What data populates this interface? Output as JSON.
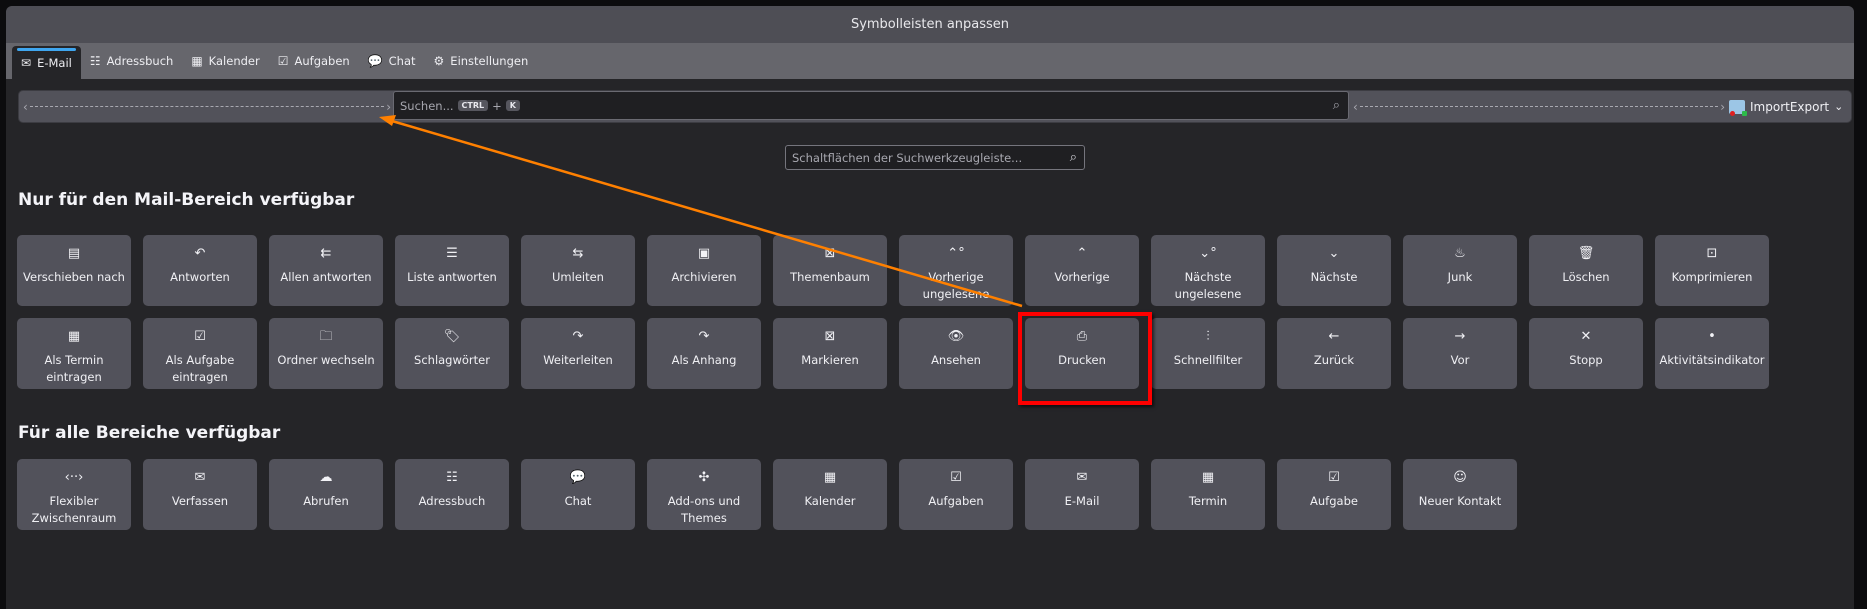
{
  "window": {
    "title": "Symbolleisten anpassen"
  },
  "tabs": [
    {
      "label": "E-Mail",
      "icon": "mail-icon",
      "glyph": "✉",
      "active": true
    },
    {
      "label": "Adressbuch",
      "icon": "address-book-icon",
      "glyph": "☷"
    },
    {
      "label": "Kalender",
      "icon": "calendar-icon",
      "glyph": "▦"
    },
    {
      "label": "Aufgaben",
      "icon": "tasks-icon",
      "glyph": "☑"
    },
    {
      "label": "Chat",
      "icon": "chat-icon",
      "glyph": "💬"
    },
    {
      "label": "Einstellungen",
      "icon": "gear-icon",
      "glyph": "⚙"
    }
  ],
  "toolbar": {
    "search_placeholder": "Suchen...",
    "shortcut_key1": "CTRL",
    "shortcut_plus": "+",
    "shortcut_key2": "K",
    "importexport_label": "ImportExport"
  },
  "filter": {
    "placeholder": "Schaltflächen der Suchwerkzeugleiste..."
  },
  "sections": [
    {
      "title": "Nur für den Mail-Bereich verfügbar",
      "rows": [
        [
          {
            "label": "Verschieben nach",
            "icon": "file-move-icon",
            "glyph": "▤"
          },
          {
            "label": "Antworten",
            "icon": "reply-icon",
            "glyph": "↶"
          },
          {
            "label": "Allen antworten",
            "icon": "reply-all-icon",
            "glyph": "⇇"
          },
          {
            "label": "Liste antworten",
            "icon": "reply-list-icon",
            "glyph": "☰"
          },
          {
            "label": "Umleiten",
            "icon": "redirect-icon",
            "glyph": "⇆"
          },
          {
            "label": "Archivieren",
            "icon": "archive-icon",
            "glyph": "▣"
          },
          {
            "label": "Themenbaum",
            "icon": "thread-icon",
            "glyph": "⊠"
          },
          {
            "label": "Vorherige ungelesene",
            "icon": "previous-unread-icon",
            "glyph": "⌃°"
          },
          {
            "label": "Vorherige",
            "icon": "chevron-up-icon",
            "glyph": "⌃"
          },
          {
            "label": "Nächste ungelesene",
            "icon": "next-unread-icon",
            "glyph": "⌄°"
          },
          {
            "label": "Nächste",
            "icon": "chevron-down-icon",
            "glyph": "⌄"
          },
          {
            "label": "Junk",
            "icon": "junk-flame-icon",
            "glyph": "♨"
          },
          {
            "label": "Löschen",
            "icon": "trash-icon",
            "glyph": "🗑"
          },
          {
            "label": "Komprimieren",
            "icon": "compact-icon",
            "glyph": "⊡"
          }
        ],
        [
          {
            "label": "Als Termin eintragen",
            "icon": "calendar-add-icon",
            "glyph": "▦"
          },
          {
            "label": "Als Aufgabe eintragen",
            "icon": "task-add-icon",
            "glyph": "☑"
          },
          {
            "label": "Ordner wechseln",
            "icon": "folder-icon",
            "glyph": "🗀"
          },
          {
            "label": "Schlagwörter",
            "icon": "tag-icon",
            "glyph": "🏷"
          },
          {
            "label": "Weiterleiten",
            "icon": "forward-icon",
            "glyph": "↷"
          },
          {
            "label": "Als Anhang",
            "icon": "forward-attachment-icon",
            "glyph": "↷"
          },
          {
            "label": "Markieren",
            "icon": "mark-icon",
            "glyph": "⊠"
          },
          {
            "label": "Ansehen",
            "icon": "eye-icon",
            "glyph": "👁"
          },
          {
            "label": "Drucken",
            "icon": "printer-icon",
            "glyph": "⎙"
          },
          {
            "label": "Schnellfilter",
            "icon": "sliders-icon",
            "glyph": "⫶"
          },
          {
            "label": "Zurück",
            "icon": "arrow-left-icon",
            "glyph": "←"
          },
          {
            "label": "Vor",
            "icon": "arrow-right-icon",
            "glyph": "→"
          },
          {
            "label": "Stopp",
            "icon": "close-icon",
            "glyph": "✕"
          },
          {
            "label": "Aktivitätsindikator",
            "icon": "dot-icon",
            "glyph": "•"
          }
        ]
      ]
    },
    {
      "title": "Für alle Bereiche verfügbar",
      "rows": [
        [
          {
            "label": "Flexibler Zwischenraum",
            "icon": "flexible-space-icon",
            "glyph": "‹··›"
          },
          {
            "label": "Verfassen",
            "icon": "compose-icon",
            "glyph": "✉"
          },
          {
            "label": "Abrufen",
            "icon": "cloud-download-icon",
            "glyph": "☁"
          },
          {
            "label": "Adressbuch",
            "icon": "address-book-icon",
            "glyph": "☷"
          },
          {
            "label": "Chat",
            "icon": "chat-icon",
            "glyph": "💬"
          },
          {
            "label": "Add-ons und Themes",
            "icon": "puzzle-icon",
            "glyph": "✣"
          },
          {
            "label": "Kalender",
            "icon": "calendar-icon",
            "glyph": "▦"
          },
          {
            "label": "Aufgaben",
            "icon": "tasks-icon",
            "glyph": "☑"
          },
          {
            "label": "E-Mail",
            "icon": "mail-icon",
            "glyph": "✉"
          },
          {
            "label": "Termin",
            "icon": "event-icon",
            "glyph": "▦"
          },
          {
            "label": "Aufgabe",
            "icon": "task-icon",
            "glyph": "☑"
          },
          {
            "label": "Neuer Kontakt",
            "icon": "new-contact-icon",
            "glyph": "☺"
          }
        ]
      ]
    }
  ],
  "annotation": {
    "highlighted_button": "Drucken",
    "arrow_color": "#ff8000",
    "box_color": "#ff0000"
  },
  "colors": {
    "accent": "#3fa6ef",
    "button_bg": "#52525b",
    "window_bg": "#252528"
  }
}
